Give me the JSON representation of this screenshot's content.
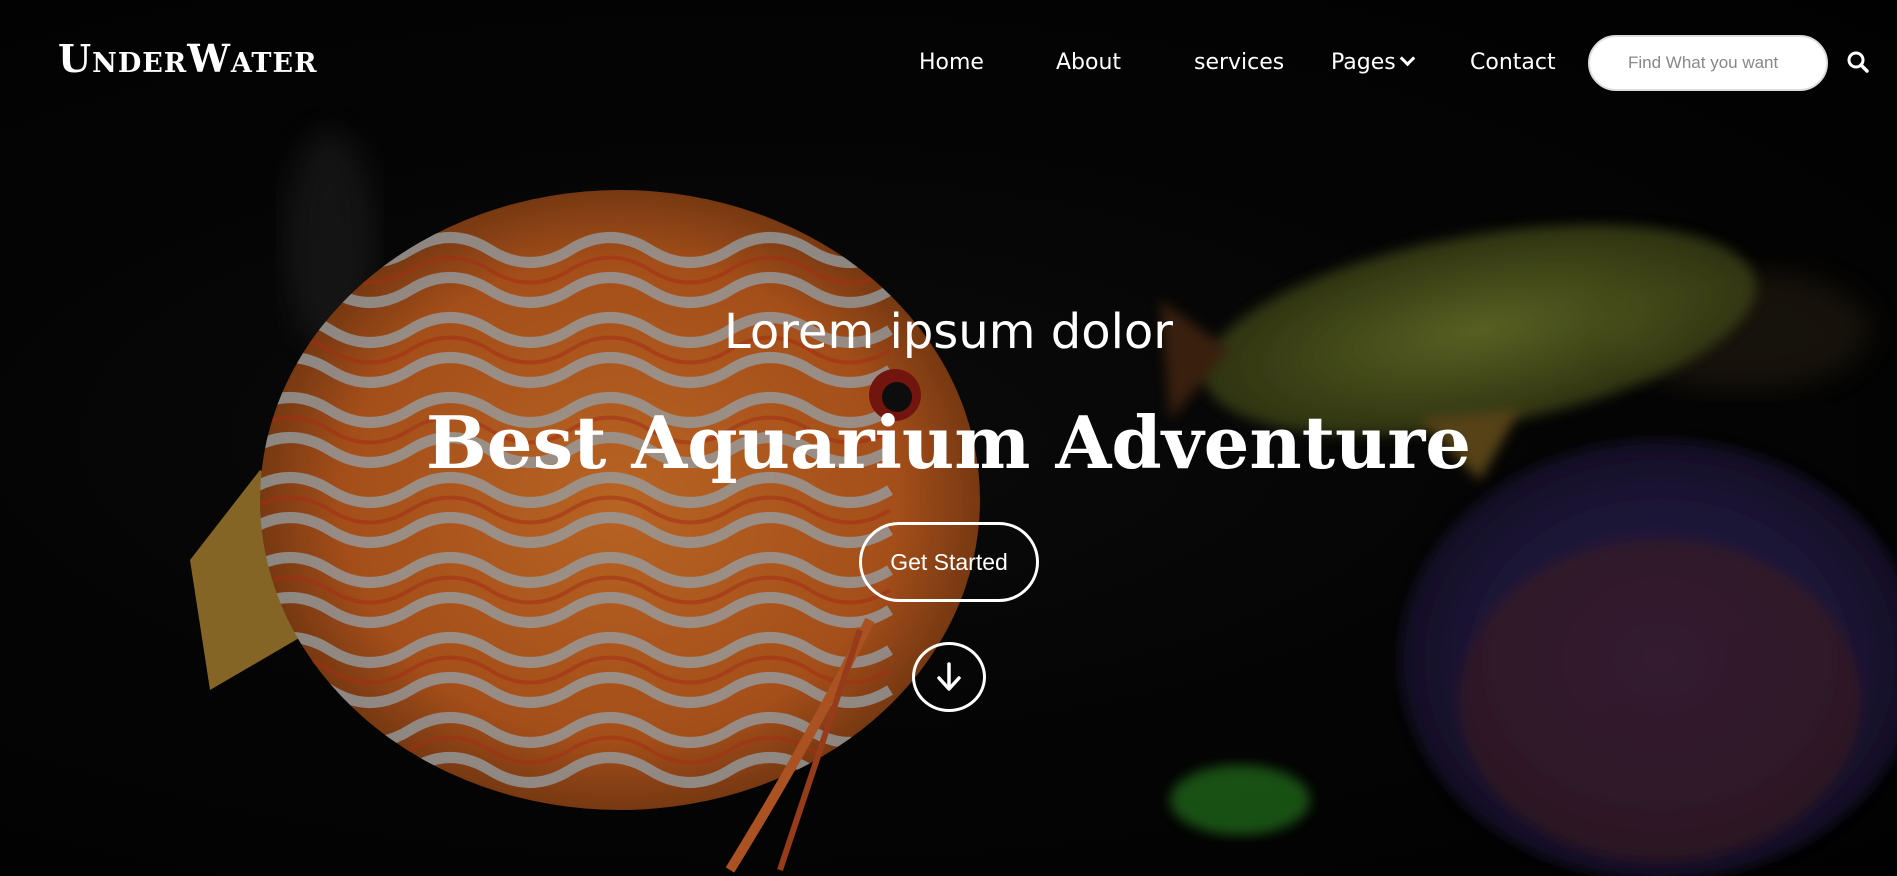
{
  "header": {
    "logo_text": "UnderWater",
    "nav": {
      "home": "Home",
      "about": "About",
      "services": "services",
      "pages": "Pages",
      "contact": "Contact"
    },
    "search": {
      "placeholder": "Find What you want",
      "icon": "search-icon"
    }
  },
  "hero": {
    "subtitle": "Lorem ipsum dolor",
    "title": "Best Aquarium Adventure",
    "cta_label": "Get Started",
    "scroll_icon": "arrow-down-icon",
    "background": "aquarium-fish-photo"
  },
  "colors": {
    "text": "#ffffff",
    "background": "#050505",
    "search_bg": "#ffffff",
    "fish_orange": "#e8782a",
    "fish_stripe": "#b9c7cf",
    "fish_green": "#8a9a2c",
    "fish_blue": "#2a3a8a"
  }
}
